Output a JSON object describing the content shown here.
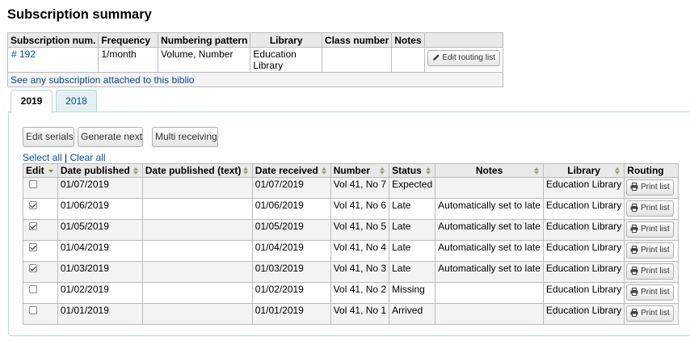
{
  "page": {
    "title": "Subscription summary"
  },
  "summary": {
    "headers": [
      "Subscription num.",
      "Frequency",
      "Numbering pattern",
      "Library",
      "Class number",
      "Notes",
      ""
    ],
    "row": {
      "subscription_num": "# 192",
      "frequency": "1/month",
      "numbering_pattern": "Volume, Number",
      "library": "Education Library",
      "class_number": "",
      "notes": "",
      "edit_routing_label": "Edit routing list"
    },
    "see_any_link": "See any subscription attached to this biblio"
  },
  "tabs": [
    {
      "label": "2019",
      "active": true
    },
    {
      "label": "2018",
      "active": false
    }
  ],
  "actions": {
    "edit_serials": "Edit serials",
    "generate_next": "Generate next",
    "multi_receiving": "Multi receiving"
  },
  "select": {
    "select_all": "Select all",
    "separator": "|",
    "clear_all": "Clear all"
  },
  "serials": {
    "headers": [
      "Edit",
      "Date published",
      "Date published (text)",
      "Date received",
      "Number",
      "Status",
      "Notes",
      "Library",
      "Routing"
    ],
    "print_label": "Print list",
    "rows": [
      {
        "checked": false,
        "date_published": "01/07/2019",
        "date_published_text": "",
        "date_received": "01/07/2019",
        "number": "Vol 41, No 7",
        "status": "Expected",
        "notes": "",
        "library": "Education Library"
      },
      {
        "checked": true,
        "date_published": "01/06/2019",
        "date_published_text": "",
        "date_received": "01/06/2019",
        "number": "Vol 41, No 6",
        "status": "Late",
        "notes": "Automatically set to late",
        "library": "Education Library"
      },
      {
        "checked": true,
        "date_published": "01/05/2019",
        "date_published_text": "",
        "date_received": "01/05/2019",
        "number": "Vol 41, No 5",
        "status": "Late",
        "notes": "Automatically set to late",
        "library": "Education Library"
      },
      {
        "checked": true,
        "date_published": "01/04/2019",
        "date_published_text": "",
        "date_received": "01/04/2019",
        "number": "Vol 41, No 4",
        "status": "Late",
        "notes": "Automatically set to late",
        "library": "Education Library"
      },
      {
        "checked": true,
        "date_published": "01/03/2019",
        "date_published_text": "",
        "date_received": "01/03/2019",
        "number": "Vol 41, No 3",
        "status": "Late",
        "notes": "Automatically set to late",
        "library": "Education Library"
      },
      {
        "checked": false,
        "date_published": "01/02/2019",
        "date_published_text": "",
        "date_received": "01/02/2019",
        "number": "Vol 41, No 2",
        "status": "Missing",
        "notes": "",
        "library": "Education Library"
      },
      {
        "checked": false,
        "date_published": "01/01/2019",
        "date_published_text": "",
        "date_received": "01/01/2019",
        "number": "Vol 41, No 1",
        "status": "Arrived",
        "notes": "",
        "library": "Education Library"
      }
    ]
  },
  "icons": {
    "edit": "pencil-icon",
    "print": "printer-icon",
    "sort": "sort-icon",
    "sort_active": "sort-desc-icon"
  }
}
